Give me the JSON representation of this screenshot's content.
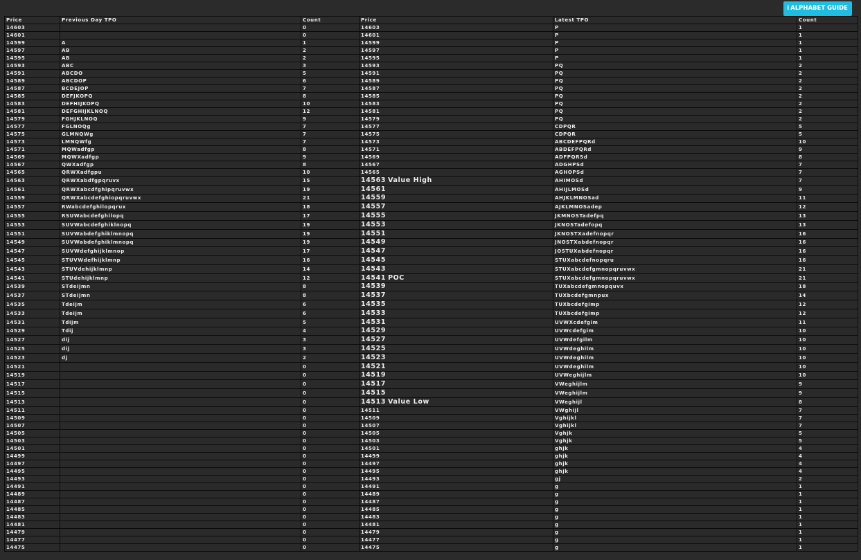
{
  "header": {
    "guide_button_label": "ALPHABET GUIDE",
    "guide_icon": "info-icon",
    "accent_color": "#1ebde3",
    "value_area_color": "#25d6a0"
  },
  "table": {
    "columns": [
      "Price",
      "Previous Day TPO",
      "Count",
      "Price",
      "Latest TPO",
      "Count"
    ],
    "rows": [
      {
        "p1": "14603",
        "prev": "",
        "c1": "0",
        "p2": "14603",
        "mark": "",
        "latest": "P",
        "c2": "1",
        "va": false
      },
      {
        "p1": "14601",
        "prev": "",
        "c1": "0",
        "p2": "14601",
        "mark": "",
        "latest": "P",
        "c2": "1",
        "va": false
      },
      {
        "p1": "14599",
        "prev": "A",
        "c1": "1",
        "p2": "14599",
        "mark": "",
        "latest": "P",
        "c2": "1",
        "va": false
      },
      {
        "p1": "14597",
        "prev": "AB",
        "c1": "2",
        "p2": "14597",
        "mark": "",
        "latest": "P",
        "c2": "1",
        "va": false
      },
      {
        "p1": "14595",
        "prev": "AB",
        "c1": "2",
        "p2": "14595",
        "mark": "",
        "latest": "P",
        "c2": "1",
        "va": false
      },
      {
        "p1": "14593",
        "prev": "ABC",
        "c1": "3",
        "p2": "14593",
        "mark": "",
        "latest": "PQ",
        "c2": "2",
        "va": false
      },
      {
        "p1": "14591",
        "prev": "ABCDO",
        "c1": "5",
        "p2": "14591",
        "mark": "",
        "latest": "PQ",
        "c2": "2",
        "va": false
      },
      {
        "p1": "14589",
        "prev": "ABCDOP",
        "c1": "6",
        "p2": "14589",
        "mark": "",
        "latest": "PQ",
        "c2": "2",
        "va": false
      },
      {
        "p1": "14587",
        "prev": "BCDEJOP",
        "c1": "7",
        "p2": "14587",
        "mark": "",
        "latest": "PQ",
        "c2": "2",
        "va": false
      },
      {
        "p1": "14585",
        "prev": "DEFJKOPQ",
        "c1": "8",
        "p2": "14585",
        "mark": "",
        "latest": "PQ",
        "c2": "2",
        "va": false
      },
      {
        "p1": "14583",
        "prev": "DEFHIJKOPQ",
        "c1": "10",
        "p2": "14583",
        "mark": "",
        "latest": "PQ",
        "c2": "2",
        "va": false
      },
      {
        "p1": "14581",
        "prev": "DEFGHIJKLNOQ",
        "c1": "12",
        "p2": "14581",
        "mark": "",
        "latest": "PQ",
        "c2": "2",
        "va": false
      },
      {
        "p1": "14579",
        "prev": "FGHJKLNOQ",
        "c1": "9",
        "p2": "14579",
        "mark": "",
        "latest": "PQ",
        "c2": "2",
        "va": false
      },
      {
        "p1": "14577",
        "prev": "FGLNOQg",
        "c1": "7",
        "p2": "14577",
        "mark": "",
        "latest": "CDPQR",
        "c2": "5",
        "va": false
      },
      {
        "p1": "14575",
        "prev": "GLMNQWg",
        "c1": "7",
        "p2": "14575",
        "mark": "",
        "latest": "CDPQR",
        "c2": "5",
        "va": false
      },
      {
        "p1": "14573",
        "prev": "LMNQWfg",
        "c1": "7",
        "p2": "14573",
        "mark": "",
        "latest": "ABCDEFPQRd",
        "c2": "10",
        "va": false
      },
      {
        "p1": "14571",
        "prev": "MQWadfgp",
        "c1": "8",
        "p2": "14571",
        "mark": "",
        "latest": "ABDEFPQRd",
        "c2": "9",
        "va": false
      },
      {
        "p1": "14569",
        "prev": "MQWXadfgp",
        "c1": "9",
        "p2": "14569",
        "mark": "",
        "latest": "ADFPQRSd",
        "c2": "8",
        "va": false
      },
      {
        "p1": "14567",
        "prev": "QWXadfgp",
        "c1": "8",
        "p2": "14567",
        "mark": "",
        "latest": "ADGHPSd",
        "c2": "7",
        "va": false
      },
      {
        "p1": "14565",
        "prev": "QRWXadfgpu",
        "c1": "10",
        "p2": "14565",
        "mark": "",
        "latest": "AGHOPSd",
        "c2": "7",
        "va": false
      },
      {
        "p1": "14563",
        "prev": "QRWXabdfgpqruvx",
        "c1": "15",
        "p2": "14563",
        "mark": "Value High",
        "latest": "AHIMOSd",
        "c2": "7",
        "va": true
      },
      {
        "p1": "14561",
        "prev": "QRWXabcdfghipqruvwx",
        "c1": "19",
        "p2": "14561",
        "mark": "",
        "latest": "AHIJLMOSd",
        "c2": "9",
        "va": true
      },
      {
        "p1": "14559",
        "prev": "QRWXabcdefghiopqruvwx",
        "c1": "21",
        "p2": "14559",
        "mark": "",
        "latest": "AHJKLMNOSad",
        "c2": "11",
        "va": true
      },
      {
        "p1": "14557",
        "prev": "RWabcdefghilopqrux",
        "c1": "18",
        "p2": "14557",
        "mark": "",
        "latest": "AJKLMNOSadep",
        "c2": "12",
        "va": true
      },
      {
        "p1": "14555",
        "prev": "RSUWabcdefghilopq",
        "c1": "17",
        "p2": "14555",
        "mark": "",
        "latest": "JKMNOSTadefpq",
        "c2": "13",
        "va": true
      },
      {
        "p1": "14553",
        "prev": "SUVWabcdefghiklnopq",
        "c1": "19",
        "p2": "14553",
        "mark": "",
        "latest": "JKNOSTadefopq",
        "c2": "13",
        "va": true
      },
      {
        "p1": "14551",
        "prev": "SUVWabdefghiklmnopq",
        "c1": "19",
        "p2": "14551",
        "mark": "",
        "latest": "JKNOSTXadefnopqr",
        "c2": "16",
        "va": true
      },
      {
        "p1": "14549",
        "prev": "SUVWabdefghiklmnopq",
        "c1": "19",
        "p2": "14549",
        "mark": "",
        "latest": "JNOSTXabdefnopqr",
        "c2": "16",
        "va": true
      },
      {
        "p1": "14547",
        "prev": "SUVWdefghijklmnop",
        "c1": "17",
        "p2": "14547",
        "mark": "",
        "latest": "JOSTUXabdefnopqr",
        "c2": "16",
        "va": true
      },
      {
        "p1": "14545",
        "prev": "STUVWdefhijklmnp",
        "c1": "16",
        "p2": "14545",
        "mark": "",
        "latest": "STUXabcdefnopqru",
        "c2": "16",
        "va": true
      },
      {
        "p1": "14543",
        "prev": "STUVdehijklmnp",
        "c1": "14",
        "p2": "14543",
        "mark": "",
        "latest": "STUXabcdefgmnopqruvwx",
        "c2": "21",
        "va": true
      },
      {
        "p1": "14541",
        "prev": "STUdehijklmnp",
        "c1": "12",
        "p2": "14541",
        "mark": "POC",
        "latest": "STUXabcdefgmnopqruvwx",
        "c2": "21",
        "va": true
      },
      {
        "p1": "14539",
        "prev": "STdeijmn",
        "c1": "8",
        "p2": "14539",
        "mark": "",
        "latest": "TUXabcdefgmnopquvx",
        "c2": "18",
        "va": true
      },
      {
        "p1": "14537",
        "prev": "STdeijmn",
        "c1": "8",
        "p2": "14537",
        "mark": "",
        "latest": "TUXbcdefgmnpux",
        "c2": "14",
        "va": true
      },
      {
        "p1": "14535",
        "prev": "Tdeijm",
        "c1": "6",
        "p2": "14535",
        "mark": "",
        "latest": "TUXbcdefgimp",
        "c2": "12",
        "va": true
      },
      {
        "p1": "14533",
        "prev": "Tdeijm",
        "c1": "6",
        "p2": "14533",
        "mark": "",
        "latest": "TUXbcdefgimp",
        "c2": "12",
        "va": true
      },
      {
        "p1": "14531",
        "prev": "Tdijm",
        "c1": "5",
        "p2": "14531",
        "mark": "",
        "latest": "UVWXcdefgim",
        "c2": "11",
        "va": true
      },
      {
        "p1": "14529",
        "prev": "Tdij",
        "c1": "4",
        "p2": "14529",
        "mark": "",
        "latest": "UVWcdefgim",
        "c2": "10",
        "va": true
      },
      {
        "p1": "14527",
        "prev": "dij",
        "c1": "3",
        "p2": "14527",
        "mark": "",
        "latest": "UVWdefgilm",
        "c2": "10",
        "va": true
      },
      {
        "p1": "14525",
        "prev": "dij",
        "c1": "3",
        "p2": "14525",
        "mark": "",
        "latest": "UVWdeghilm",
        "c2": "10",
        "va": true
      },
      {
        "p1": "14523",
        "prev": "dj",
        "c1": "2",
        "p2": "14523",
        "mark": "",
        "latest": "UVWdeghilm",
        "c2": "10",
        "va": true
      },
      {
        "p1": "14521",
        "prev": "",
        "c1": "0",
        "p2": "14521",
        "mark": "",
        "latest": "UVWdeghilm",
        "c2": "10",
        "va": true
      },
      {
        "p1": "14519",
        "prev": "",
        "c1": "0",
        "p2": "14519",
        "mark": "",
        "latest": "UVWeghijlm",
        "c2": "10",
        "va": true
      },
      {
        "p1": "14517",
        "prev": "",
        "c1": "0",
        "p2": "14517",
        "mark": "",
        "latest": "VWeghijlm",
        "c2": "9",
        "va": true
      },
      {
        "p1": "14515",
        "prev": "",
        "c1": "0",
        "p2": "14515",
        "mark": "",
        "latest": "VWeghijlm",
        "c2": "9",
        "va": true
      },
      {
        "p1": "14513",
        "prev": "",
        "c1": "0",
        "p2": "14513",
        "mark": "Value Low",
        "latest": "VWeghijl",
        "c2": "8",
        "va": true
      },
      {
        "p1": "14511",
        "prev": "",
        "c1": "0",
        "p2": "14511",
        "mark": "",
        "latest": "VWghijl",
        "c2": "7",
        "va": false
      },
      {
        "p1": "14509",
        "prev": "",
        "c1": "0",
        "p2": "14509",
        "mark": "",
        "latest": "Vghijkl",
        "c2": "7",
        "va": false
      },
      {
        "p1": "14507",
        "prev": "",
        "c1": "0",
        "p2": "14507",
        "mark": "",
        "latest": "Vghijkl",
        "c2": "7",
        "va": false
      },
      {
        "p1": "14505",
        "prev": "",
        "c1": "0",
        "p2": "14505",
        "mark": "",
        "latest": "Vghjk",
        "c2": "5",
        "va": false
      },
      {
        "p1": "14503",
        "prev": "",
        "c1": "0",
        "p2": "14503",
        "mark": "",
        "latest": "Vghjk",
        "c2": "5",
        "va": false
      },
      {
        "p1": "14501",
        "prev": "",
        "c1": "0",
        "p2": "14501",
        "mark": "",
        "latest": "ghjk",
        "c2": "4",
        "va": false
      },
      {
        "p1": "14499",
        "prev": "",
        "c1": "0",
        "p2": "14499",
        "mark": "",
        "latest": "ghjk",
        "c2": "4",
        "va": false
      },
      {
        "p1": "14497",
        "prev": "",
        "c1": "0",
        "p2": "14497",
        "mark": "",
        "latest": "ghjk",
        "c2": "4",
        "va": false
      },
      {
        "p1": "14495",
        "prev": "",
        "c1": "0",
        "p2": "14495",
        "mark": "",
        "latest": "ghjk",
        "c2": "4",
        "va": false
      },
      {
        "p1": "14493",
        "prev": "",
        "c1": "0",
        "p2": "14493",
        "mark": "",
        "latest": "gj",
        "c2": "2",
        "va": false
      },
      {
        "p1": "14491",
        "prev": "",
        "c1": "0",
        "p2": "14491",
        "mark": "",
        "latest": "g",
        "c2": "1",
        "va": false
      },
      {
        "p1": "14489",
        "prev": "",
        "c1": "0",
        "p2": "14489",
        "mark": "",
        "latest": "g",
        "c2": "1",
        "va": false
      },
      {
        "p1": "14487",
        "prev": "",
        "c1": "0",
        "p2": "14487",
        "mark": "",
        "latest": "g",
        "c2": "1",
        "va": false
      },
      {
        "p1": "14485",
        "prev": "",
        "c1": "0",
        "p2": "14485",
        "mark": "",
        "latest": "g",
        "c2": "1",
        "va": false
      },
      {
        "p1": "14483",
        "prev": "",
        "c1": "0",
        "p2": "14483",
        "mark": "",
        "latest": "g",
        "c2": "1",
        "va": false
      },
      {
        "p1": "14481",
        "prev": "",
        "c1": "0",
        "p2": "14481",
        "mark": "",
        "latest": "g",
        "c2": "1",
        "va": false
      },
      {
        "p1": "14479",
        "prev": "",
        "c1": "0",
        "p2": "14479",
        "mark": "",
        "latest": "g",
        "c2": "1",
        "va": false
      },
      {
        "p1": "14477",
        "prev": "",
        "c1": "0",
        "p2": "14477",
        "mark": "",
        "latest": "g",
        "c2": "1",
        "va": false
      },
      {
        "p1": "14475",
        "prev": "",
        "c1": "0",
        "p2": "14475",
        "mark": "",
        "latest": "g",
        "c2": "1",
        "va": false
      }
    ]
  }
}
